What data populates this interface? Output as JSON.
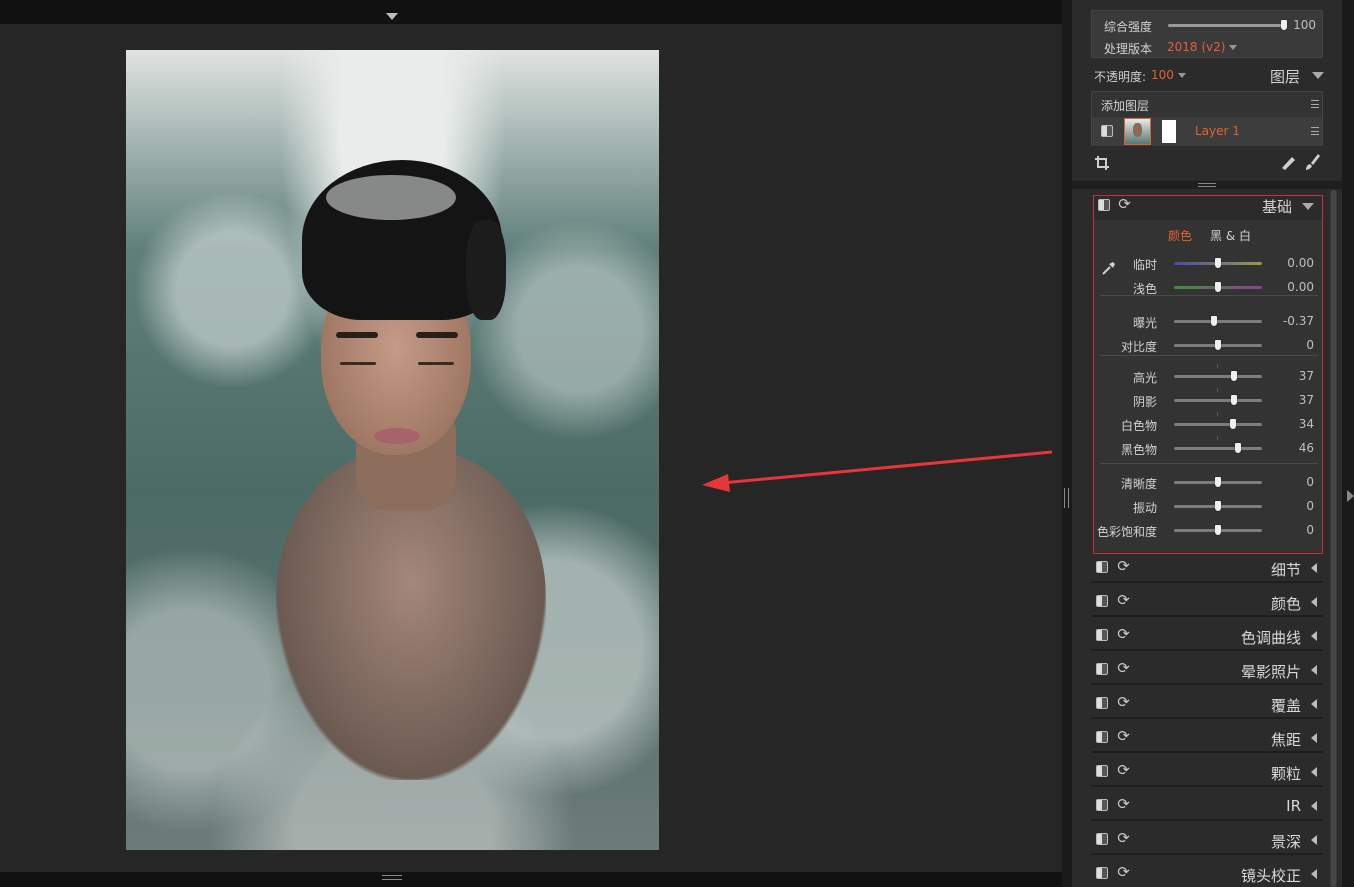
{
  "global": {
    "strength_label": "综合强度",
    "strength_value": "100",
    "strength_level": 1.0,
    "process_label": "处理版本",
    "process_value": "2018 (v2)"
  },
  "layers": {
    "opacity_label": "不透明度:",
    "opacity_value": "100",
    "title": "图层",
    "add_label": "添加图层",
    "layer_name": "Layer 1"
  },
  "basic": {
    "title": "基础",
    "tab_color": "颜色",
    "tab_bw": "黑 & 白",
    "sliders": [
      {
        "label": "临时",
        "value": "0.00",
        "level": 0.5
      },
      {
        "label": "浅色",
        "value": "0.00",
        "level": 0.5
      },
      {
        "label": "曝光",
        "value": "-0.37",
        "level": 0.46
      },
      {
        "label": "对比度",
        "value": "0",
        "level": 0.5
      },
      {
        "label": "高光",
        "value": "37",
        "level": 0.685
      },
      {
        "label": "阴影",
        "value": "37",
        "level": 0.685
      },
      {
        "label": "白色物",
        "value": "34",
        "level": 0.67
      },
      {
        "label": "黑色物",
        "value": "46",
        "level": 0.73
      },
      {
        "label": "清晰度",
        "value": "0",
        "level": 0.5
      },
      {
        "label": "振动",
        "value": "0",
        "level": 0.5
      },
      {
        "label": "色彩饱和度",
        "value": "0",
        "level": 0.5
      }
    ]
  },
  "sections": [
    {
      "title": "细节"
    },
    {
      "title": "颜色"
    },
    {
      "title": "色调曲线"
    },
    {
      "title": "晕影照片"
    },
    {
      "title": "覆盖"
    },
    {
      "title": "焦距"
    },
    {
      "title": "颗粒"
    },
    {
      "title": "IR"
    },
    {
      "title": "景深"
    },
    {
      "title": "镜头校正"
    }
  ],
  "colors": {
    "accent": "#e3612e",
    "highlight_border": "#c9323a",
    "annotation_arrow": "#e5363a"
  }
}
